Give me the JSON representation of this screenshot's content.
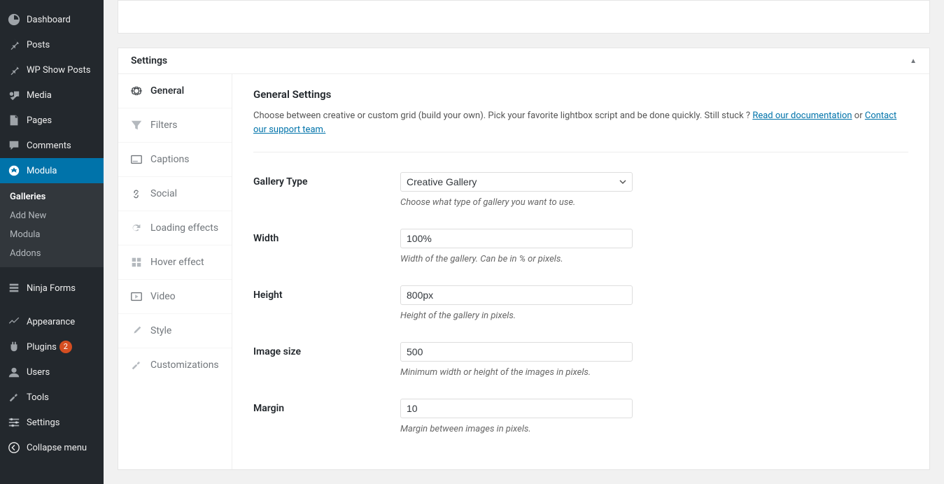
{
  "sidebar": {
    "items": [
      {
        "label": "Dashboard",
        "icon": "dashboard"
      },
      {
        "label": "Posts",
        "icon": "pin"
      },
      {
        "label": "WP Show Posts",
        "icon": "pin"
      },
      {
        "label": "Media",
        "icon": "media"
      },
      {
        "label": "Pages",
        "icon": "page"
      },
      {
        "label": "Comments",
        "icon": "comment"
      },
      {
        "label": "Modula",
        "icon": "modula",
        "active": true
      },
      {
        "label": "Ninja Forms",
        "icon": "form"
      },
      {
        "label": "Appearance",
        "icon": "appearance"
      },
      {
        "label": "Plugins",
        "icon": "plugin",
        "badge": "2"
      },
      {
        "label": "Users",
        "icon": "user"
      },
      {
        "label": "Tools",
        "icon": "tools"
      },
      {
        "label": "Settings",
        "icon": "settings"
      },
      {
        "label": "Collapse menu",
        "icon": "collapse"
      }
    ],
    "submenu": [
      {
        "label": "Galleries",
        "current": true
      },
      {
        "label": "Add New"
      },
      {
        "label": "Modula"
      },
      {
        "label": "Addons"
      }
    ]
  },
  "panel": {
    "title": "Settings"
  },
  "tabs": [
    {
      "label": "General",
      "icon": "gear",
      "active": true
    },
    {
      "label": "Filters",
      "icon": "funnel"
    },
    {
      "label": "Captions",
      "icon": "caption"
    },
    {
      "label": "Social",
      "icon": "link"
    },
    {
      "label": "Loading effects",
      "icon": "refresh"
    },
    {
      "label": "Hover effect",
      "icon": "grid"
    },
    {
      "label": "Video",
      "icon": "play"
    },
    {
      "label": "Style",
      "icon": "brush"
    },
    {
      "label": "Customizations",
      "icon": "wrench"
    }
  ],
  "form": {
    "title": "General Settings",
    "desc_part1": "Choose between creative or custom grid (build your own). Pick your favorite lightbox script and be done quickly. Still stuck ? ",
    "desc_link1": "Read our documentation",
    "desc_or": " or ",
    "desc_link2": "Contact our support team.",
    "gallery_type": {
      "label": "Gallery Type",
      "value": "Creative Gallery",
      "hint": "Choose what type of gallery you want to use."
    },
    "width": {
      "label": "Width",
      "value": "100%",
      "hint": "Width of the gallery. Can be in % or pixels."
    },
    "height": {
      "label": "Height",
      "value": "800px",
      "hint": "Height of the gallery in pixels."
    },
    "image_size": {
      "label": "Image size",
      "value": "500",
      "hint": "Minimum width or height of the images in pixels."
    },
    "margin": {
      "label": "Margin",
      "value": "10",
      "hint": "Margin between images in pixels."
    }
  }
}
